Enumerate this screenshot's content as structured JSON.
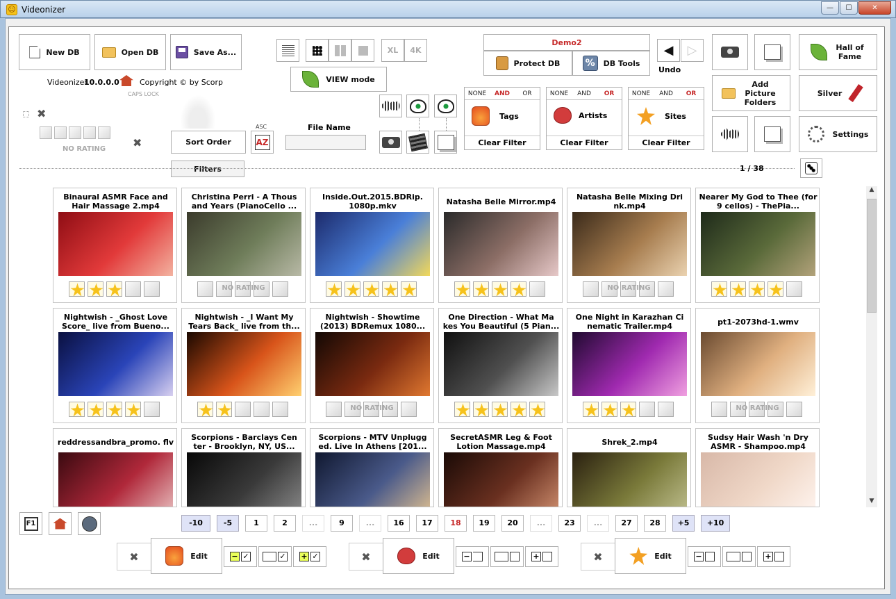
{
  "window": {
    "title": "Videonizer",
    "minimize": "—",
    "maximize": "☐",
    "close": "✕"
  },
  "toolbar": {
    "new_db": "New DB",
    "open_db": "Open DB",
    "save_as": "Save As...",
    "view_mode": "VIEW mode",
    "xl": "XL",
    "fourk": "4K",
    "db_name": "Demo2",
    "protect_db": "Protect DB",
    "db_tools": "DB Tools",
    "undo": "Undo",
    "hall_of_fame": "Hall of Fame",
    "add_picture_folders": "Add Picture Folders",
    "silver": "Silver",
    "settings": "Settings"
  },
  "about": {
    "app": "Videonizer",
    "version": "10.0.0.0",
    "copyright": "Copyright © by Scorp",
    "caps": "CAPS LOCK"
  },
  "rating_filter": {
    "label": "NO RATING"
  },
  "sort": {
    "sort_order": "Sort Order",
    "asc": "ASC",
    "az": "AZ",
    "file_name_label": "File Name",
    "file_name_value": "",
    "filters": "Filters"
  },
  "filters": [
    {
      "none": "NONE",
      "and": "AND",
      "or": "OR",
      "active": "and",
      "label": "Tags",
      "clear": "Clear Filter"
    },
    {
      "none": "NONE",
      "and": "AND",
      "or": "OR",
      "active": "or",
      "label": "Artists",
      "clear": "Clear Filter"
    },
    {
      "none": "NONE",
      "and": "AND",
      "or": "OR",
      "active": "or",
      "label": "Sites",
      "clear": "Clear Filter"
    }
  ],
  "page_indicator": "1 / 38",
  "no_rating": "NO RATING",
  "videos": [
    {
      "title": "Binaural ASMR Face and Hair Massage 2.mp4",
      "stars": 3,
      "colors": [
        "#8e0d14",
        "#e23a3a",
        "#f3b2a0"
      ]
    },
    {
      "title": "Christina Perri - A Thous and Years (PianoCello ...",
      "stars": 0,
      "colors": [
        "#3b3b2c",
        "#6f7d5a",
        "#b8b9a6"
      ]
    },
    {
      "title": "Inside.Out.2015.BDRip. 1080p.mkv",
      "stars": 5,
      "colors": [
        "#1c2a6b",
        "#4a7fd8",
        "#f2d85a"
      ]
    },
    {
      "title": "Natasha Belle Mirror.mp4",
      "stars": 4,
      "colors": [
        "#2a2a2a",
        "#8c6e66",
        "#e6c8c8"
      ]
    },
    {
      "title": "Natasha Belle Mixing Dri nk.mp4",
      "stars": 0,
      "colors": [
        "#3a2a1a",
        "#a77d4f",
        "#ead2b0"
      ]
    },
    {
      "title": "Nearer My God to Thee (for 9 cellos) - ThePia...",
      "stars": 4,
      "colors": [
        "#1e2a1a",
        "#5a6a3a",
        "#b2a27a"
      ]
    },
    {
      "title": "Nightwish - _Ghost Love Score_ live from Bueno...",
      "stars": 4,
      "colors": [
        "#0a1040",
        "#2a44b8",
        "#d8d0f0"
      ]
    },
    {
      "title": "Nightwish - _I Want My Tears Back_ live from th...",
      "stars": 2,
      "colors": [
        "#1a0800",
        "#d8541a",
        "#ffd070"
      ]
    },
    {
      "title": "Nightwish - Showtime (2013) BDRemux 1080...",
      "stars": 0,
      "colors": [
        "#120804",
        "#7a2a10",
        "#e07830"
      ]
    },
    {
      "title": "One Direction - What Ma kes You Beautiful (5 Pian...",
      "stars": 5,
      "colors": [
        "#101010",
        "#505050",
        "#c8c8c8"
      ]
    },
    {
      "title": "One Night in Karazhan Ci nematic Trailer.mp4",
      "stars": 3,
      "colors": [
        "#200a30",
        "#a02ab0",
        "#f0a0e0"
      ]
    },
    {
      "title": "pt1-2073hd-1.wmv",
      "stars": 0,
      "colors": [
        "#6a4a30",
        "#e0b080",
        "#fff0d8"
      ]
    },
    {
      "title": "reddressandbra_promo. flv",
      "stars": 0,
      "colors": [
        "#3a0a10",
        "#b0283a",
        "#e8c0c0"
      ]
    },
    {
      "title": "Scorpions - Barclays Cen ter - Brooklyn, NY, US...",
      "stars": 0,
      "colors": [
        "#080808",
        "#3a3a3a",
        "#8a8a8a"
      ]
    },
    {
      "title": "Scorpions - MTV Unplugg ed. Live In Athens [201...",
      "stars": 0,
      "colors": [
        "#101830",
        "#4a5a8a",
        "#e0c090"
      ]
    },
    {
      "title": "SecretASMR Leg & Foot Lotion Massage.mp4",
      "stars": 0,
      "colors": [
        "#1a0a06",
        "#6a3020",
        "#d09070"
      ]
    },
    {
      "title": "Shrek_2.mp4",
      "stars": 0,
      "colors": [
        "#2a2010",
        "#7a7a3a",
        "#c0c090"
      ]
    },
    {
      "title": "Sudsy Hair Wash 'n Dry ASMR - Shampoo.mp4",
      "stars": 0,
      "colors": [
        "#d8b8a8",
        "#f0d8c8",
        "#fff5f0"
      ]
    }
  ],
  "pagination": [
    "-10",
    "-5",
    "1",
    "2",
    "...",
    "9",
    "...",
    "16",
    "17",
    "18",
    "19",
    "20",
    "...",
    "23",
    "...",
    "27",
    "28",
    "+5",
    "+10"
  ],
  "bottom": {
    "f1": "F1",
    "edit": "Edit"
  }
}
